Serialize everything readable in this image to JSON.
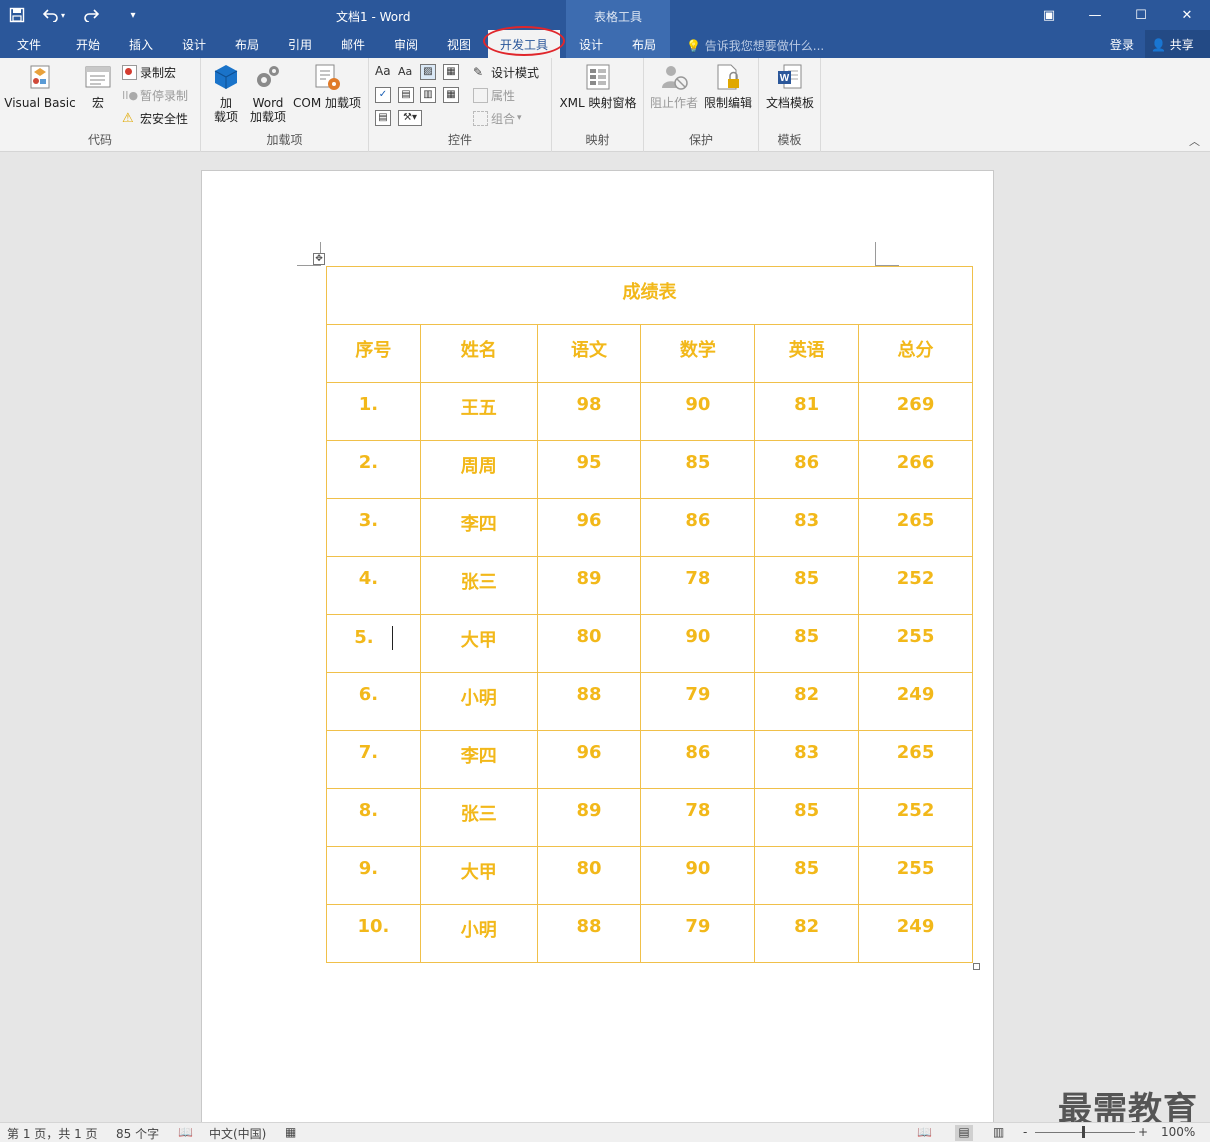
{
  "window": {
    "title": "文档1 - Word",
    "contextual_tab_group": "表格工具",
    "qat": {
      "save_icon": "save-icon",
      "undo_icon": "undo-icon",
      "redo_icon": "redo-icon",
      "customize_icon": "customize-qat-icon"
    },
    "controls": {
      "ribbon_display": "▣",
      "minimize": "—",
      "maximize": "☐",
      "close": "✕"
    }
  },
  "tabs": [
    {
      "label": "文件"
    },
    {
      "label": "开始"
    },
    {
      "label": "插入"
    },
    {
      "label": "设计"
    },
    {
      "label": "布局"
    },
    {
      "label": "引用"
    },
    {
      "label": "邮件"
    },
    {
      "label": "审阅"
    },
    {
      "label": "视图"
    },
    {
      "label": "开发工具",
      "active": true
    },
    {
      "label": "设计"
    },
    {
      "label": "布局"
    }
  ],
  "tell_me": "告诉我您想要做什么...",
  "account": {
    "login": "登录",
    "share": "共享"
  },
  "ribbon": {
    "code": {
      "label": "代码",
      "visual_basic": "Visual Basic",
      "macros": "宏",
      "record_macro": "录制宏",
      "pause_recording": "暂停录制",
      "macro_security": "宏安全性"
    },
    "addins": {
      "label": "加载项",
      "addins_line1": "加",
      "addins_line2": "载项",
      "word_addins_line1": "Word",
      "word_addins_line2": "加载项",
      "com_addins": "COM 加载项"
    },
    "controls": {
      "label": "控件",
      "design_mode": "设计模式",
      "properties": "属性",
      "group": "组合",
      "rich_text": "Aa",
      "plain_text": "Aa"
    },
    "mapping": {
      "label": "映射",
      "xml_pane": "XML 映射窗格"
    },
    "protect": {
      "label": "保护",
      "block_authors": "阻止作者",
      "restrict_editing": "限制编辑"
    },
    "templates": {
      "label": "模板",
      "document_template": "文档模板"
    }
  },
  "table": {
    "title": "成绩表",
    "headers": [
      "序号",
      "姓名",
      "语文",
      "数学",
      "英语",
      "总分"
    ],
    "rows": [
      [
        "1.",
        "王五",
        "98",
        "90",
        "81",
        "269"
      ],
      [
        "2.",
        "周周",
        "95",
        "85",
        "86",
        "266"
      ],
      [
        "3.",
        "李四",
        "96",
        "86",
        "83",
        "265"
      ],
      [
        "4.",
        "张三",
        "89",
        "78",
        "85",
        "252"
      ],
      [
        "5.",
        "大甲",
        "80",
        "90",
        "85",
        "255"
      ],
      [
        "6.",
        "小明",
        "88",
        "79",
        "82",
        "249"
      ],
      [
        "7.",
        "李四",
        "96",
        "86",
        "83",
        "265"
      ],
      [
        "8.",
        "张三",
        "89",
        "78",
        "85",
        "252"
      ],
      [
        "9.",
        "大甲",
        "80",
        "90",
        "85",
        "255"
      ],
      [
        "10.",
        "小明",
        "88",
        "79",
        "82",
        "249"
      ]
    ],
    "text_color": "#f2b81a"
  },
  "watermark": "最需教育",
  "status": {
    "page": "第 1 页，共 1 页",
    "words": "85 个字",
    "language": "中文(中国)",
    "zoom": "100%",
    "zoom_minus": "-",
    "zoom_plus": "+"
  },
  "colors": {
    "title_bar": "#2b579a",
    "contextual_group": "#3d6cb0",
    "highlight_oval": "#e0262b"
  }
}
